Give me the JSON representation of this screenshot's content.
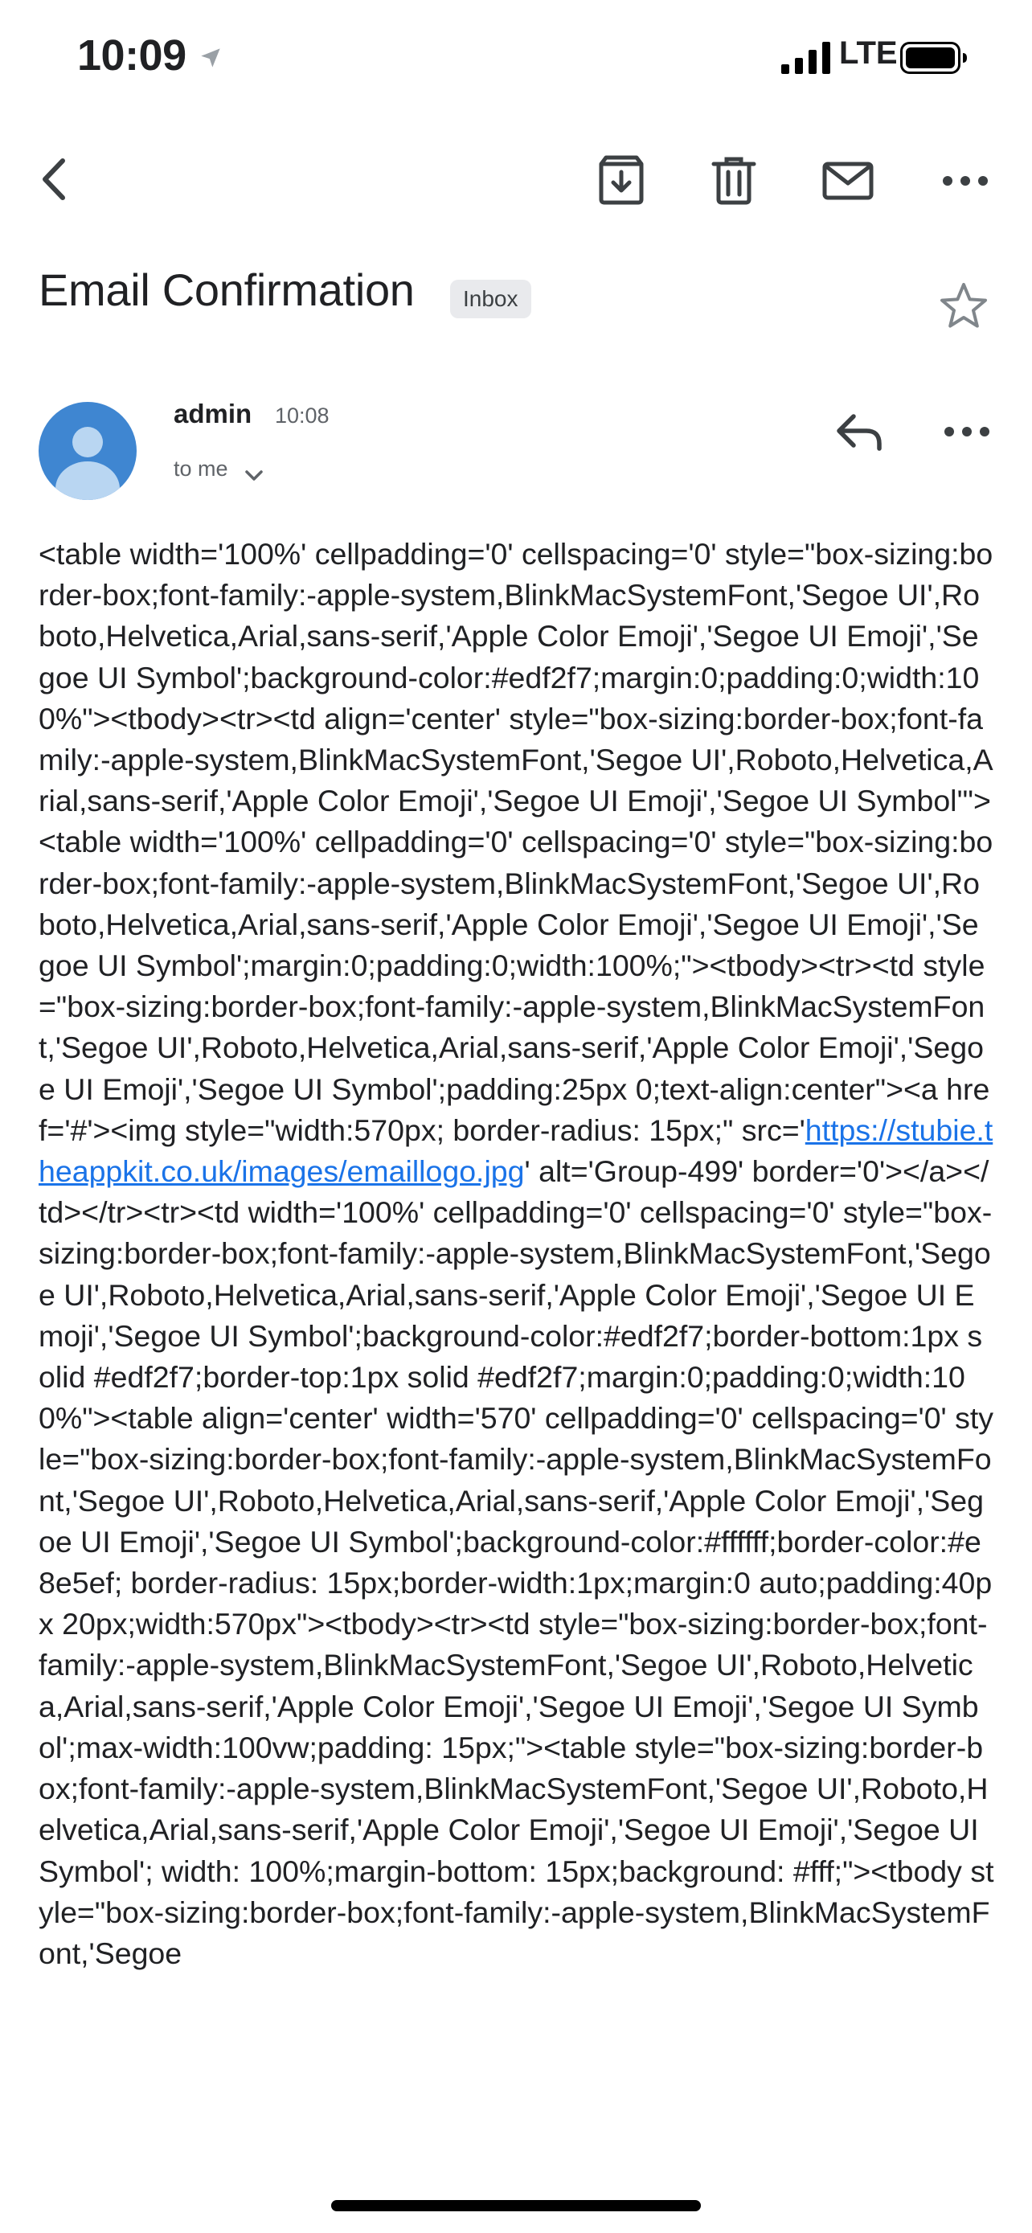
{
  "status_bar": {
    "time": "10:09",
    "network": "LTE"
  },
  "toolbar": {
    "back_icon": "chevron-left-icon",
    "archive_icon": "archive-icon",
    "delete_icon": "trash-icon",
    "unread_icon": "mail-icon",
    "more_icon": "more-horizontal-icon"
  },
  "email": {
    "subject": "Email Confirmation",
    "label": "Inbox",
    "sender": "admin",
    "time": "10:08",
    "recipient": "to me",
    "body_before_link": "<table width='100%' cellpadding='0' cellspacing='0' style=\"box-sizing:border-box;font-family:-apple-system,BlinkMacSystemFont,'Segoe UI',Roboto,Helvetica,Arial,sans-serif,'Apple Color Emoji','Segoe UI Emoji','Segoe UI Symbol';background-color:#edf2f7;margin:0;padding:0;width:100%\"><tbody><tr><td align='center' style=\"box-sizing:border-box;font-family:-apple-system,BlinkMacSystemFont,'Segoe UI',Roboto,Helvetica,Arial,sans-serif,'Apple Color Emoji','Segoe UI Emoji','Segoe UI Symbol'\"><table width='100%' cellpadding='0' cellspacing='0' style=\"box-sizing:border-box;font-family:-apple-system,BlinkMacSystemFont,'Segoe UI',Roboto,Helvetica,Arial,sans-serif,'Apple Color Emoji','Segoe UI Emoji','Segoe UI Symbol';margin:0;padding:0;width:100%;\"><tbody><tr><td style=\"box-sizing:border-box;font-family:-apple-system,BlinkMacSystemFont,'Segoe UI',Roboto,Helvetica,Arial,sans-serif,'Apple Color Emoji','Segoe UI Emoji','Segoe UI Symbol';padding:25px 0;text-align:center\"><a href='#'><img style=\"width:570px; border-radius: 15px;\" src='",
    "link_text": "https://stubie.theappkit.co.uk/images/emaillogo.jpg",
    "body_after_link": "' alt='Group-499' border='0'></a></td></tr><tr><td width='100%' cellpadding='0' cellspacing='0' style=\"box-sizing:border-box;font-family:-apple-system,BlinkMacSystemFont,'Segoe UI',Roboto,Helvetica,Arial,sans-serif,'Apple Color Emoji','Segoe UI Emoji','Segoe UI Symbol';background-color:#edf2f7;border-bottom:1px solid #edf2f7;border-top:1px solid #edf2f7;margin:0;padding:0;width:100%\"><table align='center' width='570' cellpadding='0' cellspacing='0' style=\"box-sizing:border-box;font-family:-apple-system,BlinkMacSystemFont,'Segoe UI',Roboto,Helvetica,Arial,sans-serif,'Apple Color Emoji','Segoe UI Emoji','Segoe UI Symbol';background-color:#ffffff;border-color:#e8e5ef; border-radius: 15px;border-width:1px;margin:0 auto;padding:40px 20px;width:570px\"><tbody><tr><td style=\"box-sizing:border-box;font-family:-apple-system,BlinkMacSystemFont,'Segoe UI',Roboto,Helvetica,Arial,sans-serif,'Apple Color Emoji','Segoe UI Emoji','Segoe UI Symbol';max-width:100vw;padding: 15px;\"><table style=\"box-sizing:border-box;font-family:-apple-system,BlinkMacSystemFont,'Segoe UI',Roboto,Helvetica,Arial,sans-serif,'Apple Color Emoji','Segoe UI Emoji','Segoe UI Symbol'; width: 100%;margin-bottom: 15px;background: #fff;\"><tbody style=\"box-sizing:border-box;font-family:-apple-system,BlinkMacSystemFont,'Segoe"
  },
  "colors": {
    "link": "#1a73e8",
    "avatar": "#3f86d1",
    "chip_bg": "#e9eaed"
  }
}
